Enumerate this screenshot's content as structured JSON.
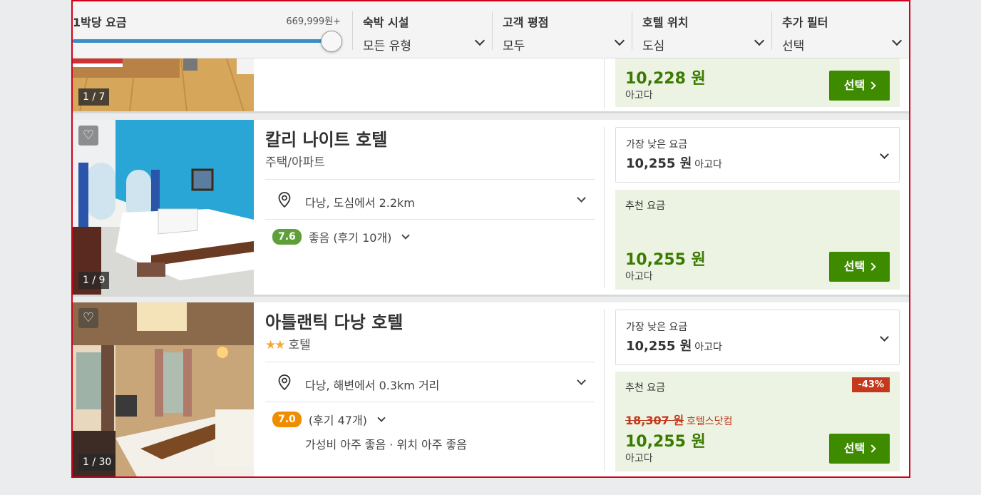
{
  "filters": {
    "price_label": "1박당 요금",
    "price_value": "669,999원+",
    "price_slider_fraction": 1.0,
    "dropdowns": [
      {
        "label": "숙박 시설",
        "value": "모든 유형"
      },
      {
        "label": "고객 평점",
        "value": "모두"
      },
      {
        "label": "호텔 위치",
        "value": "도심"
      },
      {
        "label": "추가 필터",
        "value": "선택"
      }
    ]
  },
  "hotels": [
    {
      "photo_counter": "1 / 7",
      "recommended_price": "10,228 원",
      "recommended_source": "아고다",
      "select_label": "선택"
    },
    {
      "photo_counter": "1 / 9",
      "name": "칼리 나이트 호텔",
      "type": "주택/아파트",
      "location": "다낭, 도심에서 2.2km",
      "score": "7.6",
      "rating_text": "좋음 (후기 10개)",
      "lowest_label": "가장 낮은 요금",
      "lowest_price": "10,255 원",
      "lowest_source": "아고다",
      "recommended_label": "추천 요금",
      "recommended_price": "10,255 원",
      "recommended_source": "아고다",
      "select_label": "선택"
    },
    {
      "photo_counter": "1 / 30",
      "name": "아틀랜틱 다낭 호텔",
      "stars": 2,
      "type": "호텔",
      "location": "다낭, 해변에서 0.3km 거리",
      "score": "7.0",
      "rating_text": "(후기 47개)",
      "subratings": "가성비 아주 좋음 · 위치 아주 좋음",
      "lowest_label": "가장 낮은 요금",
      "lowest_price": "10,255 원",
      "lowest_source": "아고다",
      "recommended_label": "추천 요금",
      "discount": "-43%",
      "original_price": "18,307 원",
      "original_source": "호텔스닷컴",
      "recommended_price": "10,255 원",
      "recommended_source": "아고다",
      "select_label": "선택"
    }
  ],
  "colors": {
    "accent_green": "#3f8b00",
    "price_green": "#3a7a00",
    "discount_red": "#c4391d",
    "slider_blue": "#3b8fc4",
    "highlight_border": "#d0021b"
  }
}
